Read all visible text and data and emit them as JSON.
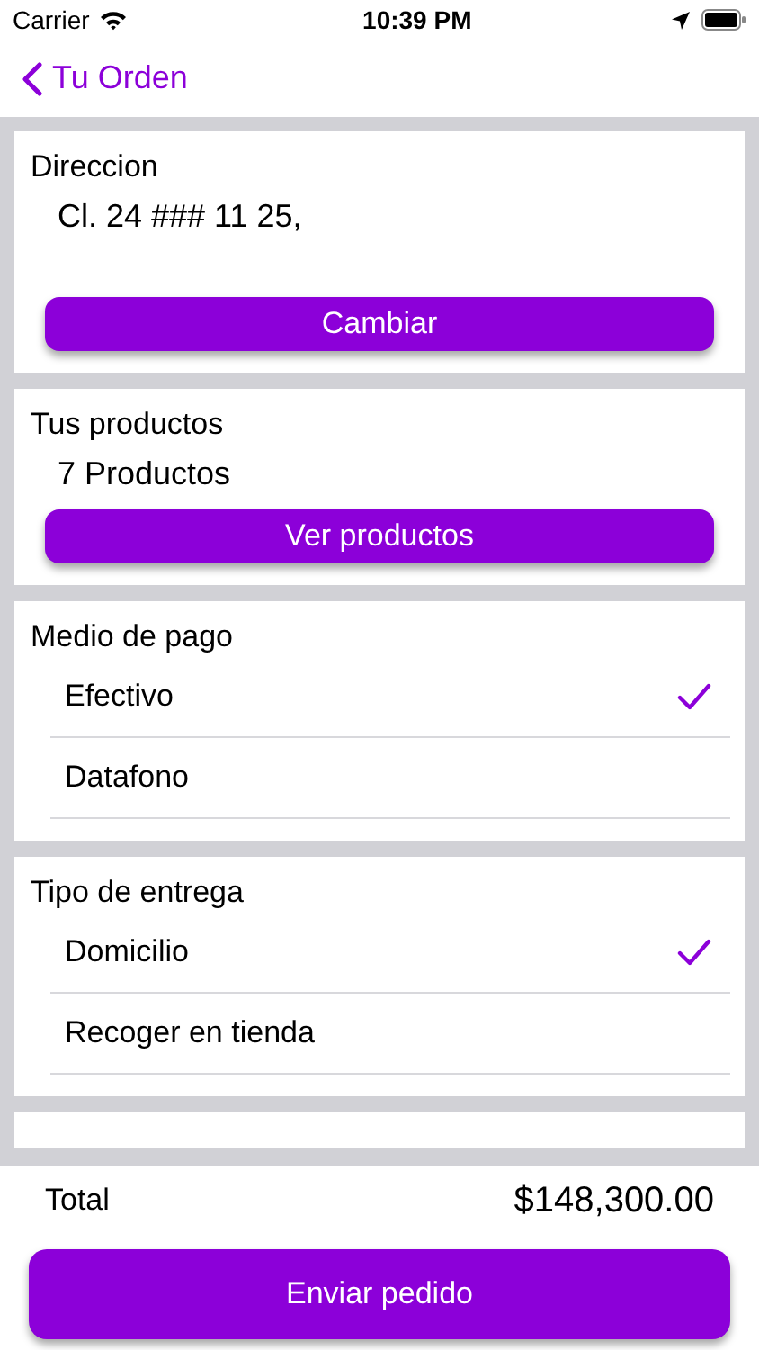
{
  "status_bar": {
    "carrier": "Carrier",
    "time": "10:39 PM"
  },
  "nav": {
    "back_label": "Tu Orden"
  },
  "sections": [
    {
      "kind": "info",
      "title": "Direccion",
      "value": "Cl. 24 ### 11 25,",
      "button": "Cambiar"
    },
    {
      "kind": "info",
      "title": "Tus productos",
      "value": "7 Productos",
      "button": "Ver productos"
    },
    {
      "kind": "options",
      "title": "Medio de pago",
      "options": [
        {
          "label": "Efectivo",
          "selected": true
        },
        {
          "label": "Datafono",
          "selected": false
        }
      ]
    },
    {
      "kind": "options",
      "title": "Tipo de entrega",
      "options": [
        {
          "label": "Domicilio",
          "selected": true
        },
        {
          "label": "Recoger en tienda",
          "selected": false
        }
      ]
    }
  ],
  "footer": {
    "total_label": "Total",
    "total_value": "$148,300.00",
    "submit": "Enviar pedido"
  }
}
